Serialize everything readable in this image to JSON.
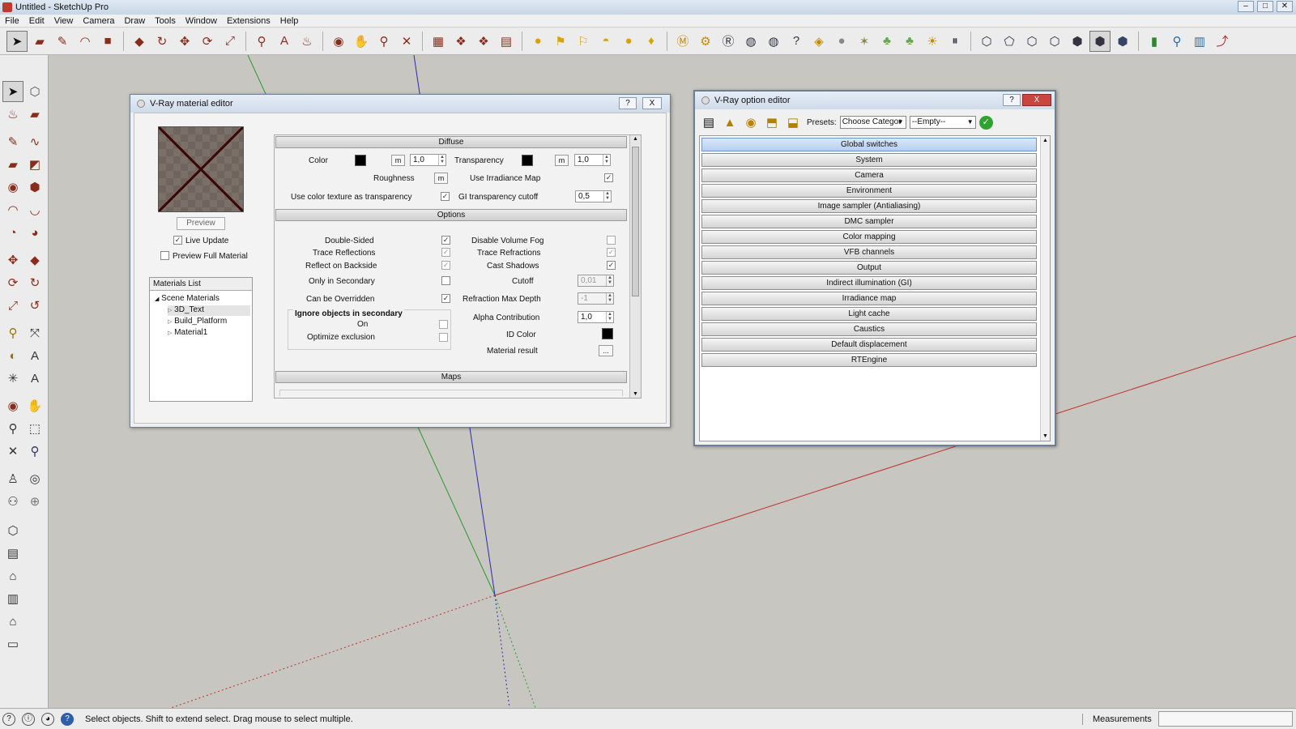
{
  "window": {
    "title": "Untitled - SketchUp Pro"
  },
  "menu": [
    "File",
    "Edit",
    "View",
    "Camera",
    "Draw",
    "Tools",
    "Window",
    "Extensions",
    "Help"
  ],
  "material_editor": {
    "title": "V-Ray material editor",
    "help_btn": "?",
    "close_btn": "X",
    "preview_label": "Preview",
    "live_update": "Live Update",
    "preview_full": "Preview Full Material",
    "materials_list_header": "Materials List",
    "scene_materials": "Scene Materials",
    "materials": [
      "3D_Text",
      "Build_Platform",
      "Material1"
    ],
    "diffuse_header": "Diffuse",
    "color_label": "Color",
    "color_value": "1,0",
    "transparency_label": "Transparency",
    "transparency_value": "1,0",
    "m_label": "m",
    "roughness_label": "Roughness",
    "use_irradiance": "Use Irradiance Map",
    "use_color_texture": "Use color texture as transparency",
    "gi_cutoff_label": "GI transparency cutoff",
    "gi_cutoff_value": "0,5",
    "options_header": "Options",
    "double_sided": "Double-Sided",
    "disable_volume_fog": "Disable Volume Fog",
    "trace_reflections": "Trace Reflections",
    "trace_refractions": "Trace Refractions",
    "reflect_backside": "Reflect on Backside",
    "cast_shadows": "Cast Shadows",
    "only_secondary": "Only in Secondary",
    "cutoff_label": "Cutoff",
    "cutoff_value": "0,01",
    "can_be_overridden": "Can be Overridden",
    "refraction_max_depth": "Refraction Max Depth",
    "refraction_max_depth_value": "-1",
    "ignore_secondary_group": "Ignore objects in secondary",
    "on_label": "On",
    "optimize_exclusion": "Optimize exclusion",
    "alpha_contribution": "Alpha Contribution",
    "alpha_value": "1,0",
    "id_color": "ID Color",
    "material_result": "Material result",
    "material_result_btn": "...",
    "maps_header": "Maps"
  },
  "option_editor": {
    "title": "V-Ray option editor",
    "help_btn": "?",
    "close_btn": "X",
    "presets_label": "Presets:",
    "category_value": "Choose Categor",
    "preset_value": "--Empty--",
    "rows": [
      "Global switches",
      "System",
      "Camera",
      "Environment",
      "Image sampler (Antialiasing)",
      "DMC sampler",
      "Color mapping",
      "VFB channels",
      "Output",
      "Indirect illumination (GI)",
      "Irradiance map",
      "Light cache",
      "Caustics",
      "Default displacement",
      "RTEngine"
    ]
  },
  "status": {
    "message": "Select objects. Shift to extend select. Drag mouse to select multiple.",
    "measurements_label": "Measurements"
  }
}
